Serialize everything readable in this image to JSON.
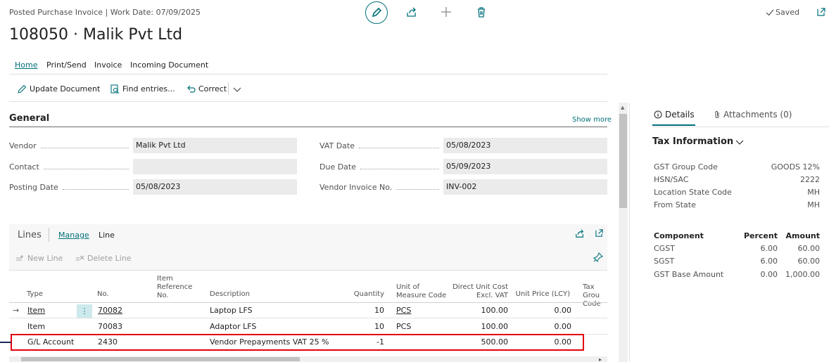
{
  "header": {
    "breadcrumb": "Posted Purchase Invoice | Work Date: 07/09/2025",
    "title": "108050 · Malik Pvt Ltd",
    "saved_label": "Saved"
  },
  "nav_tabs": [
    "Home",
    "Print/Send",
    "Invoice",
    "Incoming Document"
  ],
  "actions": {
    "update_document": "Update Document",
    "find_entries": "Find entries...",
    "correct": "Correct"
  },
  "general": {
    "title": "General",
    "show_more": "Show more",
    "fields_left": [
      {
        "label": "Vendor",
        "value": "Malik Pvt Ltd"
      },
      {
        "label": "Contact",
        "value": ""
      },
      {
        "label": "Posting Date",
        "value": "05/08/2023"
      }
    ],
    "fields_right": [
      {
        "label": "VAT Date",
        "value": "05/08/2023"
      },
      {
        "label": "Due Date",
        "value": "05/09/2023"
      },
      {
        "label": "Vendor Invoice No.",
        "value": "INV-002"
      }
    ]
  },
  "lines": {
    "title": "Lines",
    "tabs": [
      "Manage",
      "Line"
    ],
    "new_line": "New Line",
    "delete_line": "Delete Line",
    "columns": {
      "type": "Type",
      "no": "No.",
      "item_ref": "Item\nReference\nNo.",
      "description": "Description",
      "quantity": "Quantity",
      "uom": "Unit of\nMeasure Code",
      "direct_cost": "Direct Unit Cost\nExcl. VAT",
      "unit_price": "Unit Price (LCY)",
      "tax_group": "Tax Grou\nCode"
    },
    "rows": [
      {
        "type": "Item",
        "no": "70082",
        "description": "Laptop LFS",
        "quantity": "10",
        "uom": "PCS",
        "direct_cost": "100.00",
        "unit_price": "0.00"
      },
      {
        "type": "Item",
        "no": "70083",
        "description": "Adaptor LFS",
        "quantity": "10",
        "uom": "PCS",
        "direct_cost": "100.00",
        "unit_price": "0.00"
      },
      {
        "type": "G/L Account",
        "no": "2430",
        "description": "Vendor Prepayments VAT 25 %",
        "quantity": "-1",
        "uom": "",
        "direct_cost": "500.00",
        "unit_price": "0.00"
      }
    ]
  },
  "factbox": {
    "tabs": [
      "Details",
      "Attachments (0)"
    ],
    "tax_title": "Tax Information",
    "tax_rows": [
      {
        "label": "GST Group Code",
        "value": "GOODS 12%"
      },
      {
        "label": "HSN/SAC",
        "value": "2222"
      },
      {
        "label": "Location State Code",
        "value": "MH"
      },
      {
        "label": "From State",
        "value": "MH"
      }
    ],
    "component_headers": {
      "component": "Component",
      "percent": "Percent",
      "amount": "Amount"
    },
    "components": [
      {
        "component": "CGST",
        "percent": "6.00",
        "amount": "60.00"
      },
      {
        "component": "SGST",
        "percent": "6.00",
        "amount": "60.00"
      },
      {
        "component": "GST Base Amount",
        "percent": "0.00",
        "amount": "1,000.00"
      }
    ]
  },
  "colors": {
    "accent": "#00707a",
    "highlight_box": "#e3000f",
    "selected_cell": "#cde9ec"
  }
}
